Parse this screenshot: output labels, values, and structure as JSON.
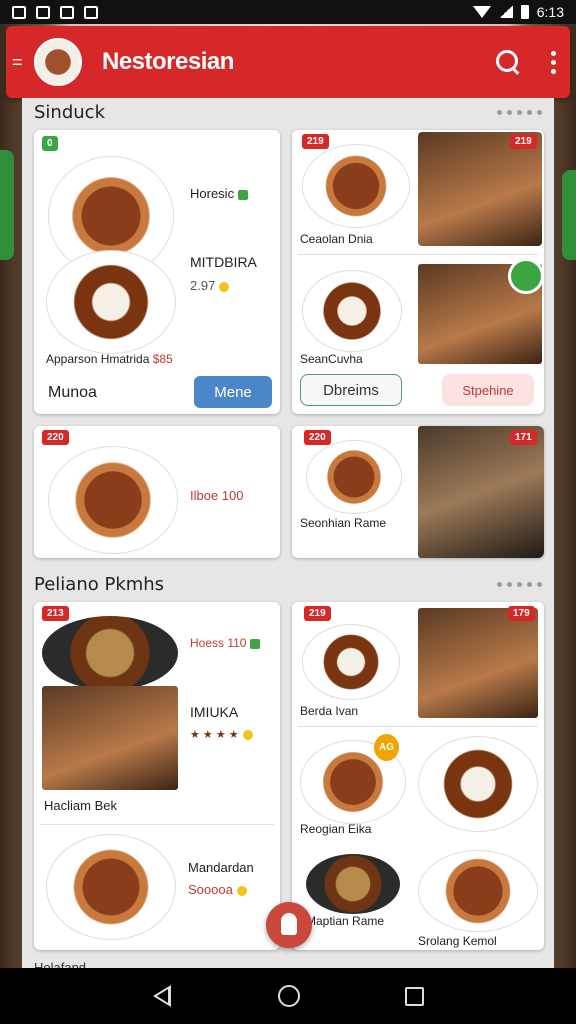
{
  "status_bar": {
    "time": "6:13"
  },
  "app_bar": {
    "title": "Nestoresian"
  },
  "sections": [
    {
      "title": "Sinduck",
      "cards": {
        "card1": {
          "badge": "0",
          "lines": [
            "Horesic",
            "MITDBIRA",
            "2.97",
            "Apparson Hmatrida"
          ],
          "tag": "$85",
          "footer_label": "Munoa",
          "button": "Mene"
        },
        "card2": {
          "items": [
            {
              "badge": "219",
              "name": "Ceaolan Dnia",
              "badge2": "219"
            },
            {
              "name": "SeanCuvha"
            }
          ],
          "buttons": [
            "Dbreims",
            "Stpehine"
          ]
        },
        "card3": {
          "badge": "220",
          "price": "Ilboe 100"
        },
        "card4": {
          "badge": "220",
          "badge2": "171",
          "name": "Seonhian Rame"
        }
      }
    },
    {
      "title": "Peliano Pkmhs",
      "cards": {
        "card5": {
          "badge": "213",
          "lines": [
            "Hoess 110",
            "IMIUKA",
            "Hacliam Bek",
            "Mandardan",
            "Sooooa"
          ],
          "rating_text": "★ ★ ★ ★"
        },
        "card6": {
          "badge": "219",
          "badge2": "179",
          "tag": "AG",
          "items": [
            "Berda Ivan",
            "Reogian Eika",
            "Maptian Rame",
            "Srolang Kemol"
          ]
        }
      }
    }
  ],
  "cut_title": "Holafand",
  "colors": {
    "brand_red": "#d62828",
    "accent_green": "#3aa541",
    "button_blue": "#4a86c8"
  }
}
